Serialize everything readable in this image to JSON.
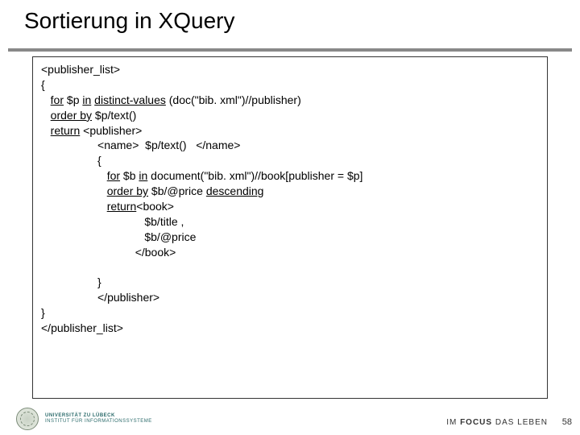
{
  "title": "Sortierung in XQuery",
  "code": {
    "l1": "<publisher_list>",
    "l2": "{",
    "l3a": "for",
    "l3b": " $p ",
    "l3c": "in",
    "l3d": " ",
    "l3e": "distinct-values",
    "l3f": " (doc(\"bib. xml\")//publisher)",
    "l4a": "order by",
    "l4b": " $p/text()",
    "l5a": "return",
    "l5b": " <publisher>",
    "l6": "<name>  $p/text()   </name>",
    "l7": "{",
    "l8a": "for",
    "l8b": " $b ",
    "l8c": "in",
    "l8d": " document(\"bib. xml\")//book[publisher = $p]",
    "l9a": "order by",
    "l9b": " $b/@price ",
    "l9c": "descending",
    "l10a": "return",
    "l10b": "<book>",
    "l11": "$b/title ,",
    "l12": "$b/@price",
    "l13": "</book>",
    "l14": "}",
    "l15": "</publisher>",
    "l16": "}",
    "l17": "</publisher_list>"
  },
  "footer": {
    "uni_line1": "UNIVERSITÄT ZU LÜBECK",
    "uni_line2": "INSTITUT FÜR INFORMATIONSSYSTEME",
    "motto_prefix": "IM ",
    "motto_bold": "FOCUS",
    "motto_suffix": " DAS LEBEN",
    "page": "58"
  }
}
